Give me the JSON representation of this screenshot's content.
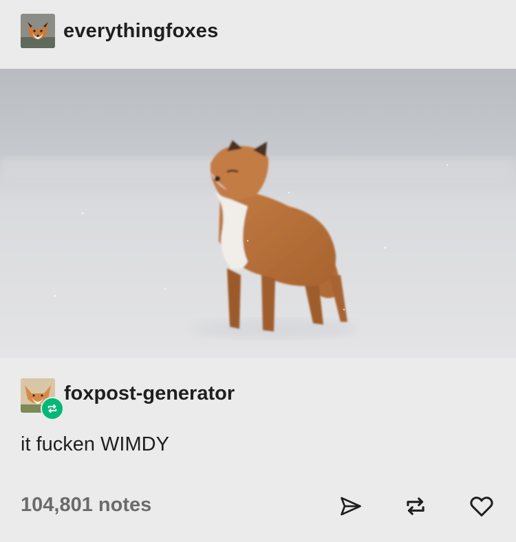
{
  "post": {
    "blog_name": "everythingfoxes",
    "reblog_name": "foxpost-generator",
    "body_text": "it fucken WIMDY",
    "notes_label": "104,801 notes"
  },
  "icons": {
    "share": "share-icon",
    "reblog": "reblog-icon",
    "like": "heart-icon",
    "reblog_badge": "reblog-badge-icon"
  },
  "colors": {
    "background": "#ebebeb",
    "text": "#1f1f1f",
    "muted": "#6b6b6b",
    "reblog_green": "#02b875"
  }
}
